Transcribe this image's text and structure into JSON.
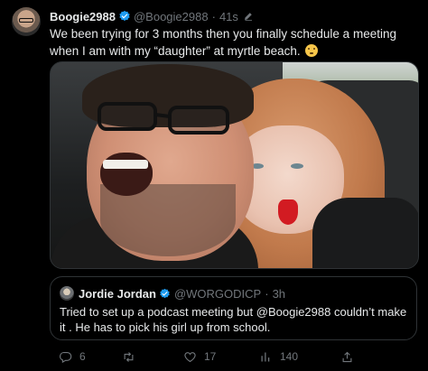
{
  "tweet": {
    "display_name": "Boogie2988",
    "handle": "@Boogie2988",
    "separator": "·",
    "time": "41s",
    "text": "We been trying for 3 months then you finally schedule a meeting when I am with my “daughter” at myrtle beach.",
    "emoji_icon": "face-with-open-mouth-emoji"
  },
  "quoted_tweet": {
    "display_name": "Jordie Jordan",
    "handle": "@WORGODICP",
    "separator": "·",
    "time": "3h",
    "text": "Tried to set up a podcast meeting but @Boogie2988  couldn’t make it . He has to pick his girl up from school."
  },
  "actions": {
    "replies": "6",
    "retweets": "",
    "likes": "17",
    "views": "140",
    "reply_icon": "reply-icon",
    "retweet_icon": "retweet-icon",
    "like_icon": "heart-icon",
    "views_icon": "views-icon",
    "share_icon": "share-icon"
  },
  "colors": {
    "background": "#000000",
    "text_primary": "#e7e9ea",
    "text_secondary": "#71767b",
    "verified": "#1d9bf0",
    "border": "#2f3336"
  }
}
